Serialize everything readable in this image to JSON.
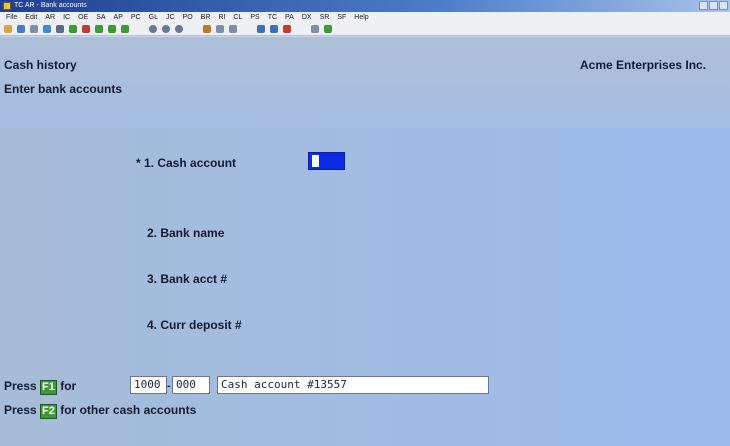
{
  "window": {
    "title": "TC AR - Bank accounts"
  },
  "menu": [
    "File",
    "Edit",
    "AR",
    "IC",
    "OE",
    "SA",
    "AP",
    "PC",
    "GL",
    "JC",
    "PO",
    "BR",
    "RI",
    "CL",
    "PS",
    "TC",
    "PA",
    "DX",
    "SR",
    "SF",
    "Help"
  ],
  "toolbar": {
    "icons": [
      "open-icon",
      "copy-icon",
      "settings-icon",
      "globe-icon",
      "menu-icon",
      "check-icon",
      "cut-icon",
      "refresh-icon",
      "up-icon",
      "down-icon",
      "circle-1-icon",
      "circle-2-icon",
      "circle-3-icon",
      "find-icon",
      "zoom-icon",
      "calc-icon",
      "prev-icon",
      "next-icon",
      "stop-icon",
      "print-icon",
      "help-icon"
    ]
  },
  "header": {
    "screen_title": "Cash history",
    "company": "Acme Enterprises Inc.",
    "subtitle": "Enter bank accounts"
  },
  "fields": [
    {
      "label": "* 1. Cash account"
    },
    {
      "label": "2. Bank name"
    },
    {
      "label": "3. Bank acct #"
    },
    {
      "label": "4. Curr deposit #"
    }
  ],
  "footer": {
    "line1_press": "Press",
    "line1_key": "F1",
    "line1_for": "for",
    "account_main": "1000",
    "account_sub": "000",
    "account_desc": "Cash account #13557",
    "line2_press": "Press",
    "line2_key": "F2",
    "line2_rest": "for other cash accounts"
  },
  "colors": {
    "field_active": "#0d2be2",
    "fkey": "#3e9a33"
  }
}
